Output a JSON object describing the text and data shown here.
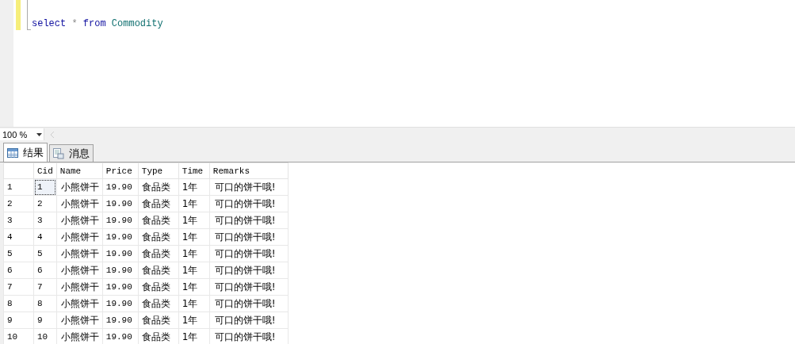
{
  "editor": {
    "query": [
      {
        "text": "select",
        "kind": "keyword"
      },
      {
        "text": "*",
        "kind": "operator"
      },
      {
        "text": "from",
        "kind": "keyword"
      },
      {
        "text": "Commodity",
        "kind": "identifier"
      }
    ]
  },
  "zoom": {
    "value": "100 %"
  },
  "tabs": [
    {
      "label": "结果",
      "selected": true,
      "kind": "grid"
    },
    {
      "label": "消息",
      "selected": false,
      "kind": "messages"
    }
  ],
  "table": {
    "columns": [
      "Cid",
      "Name",
      "Price",
      "Type",
      "Time",
      "Remarks"
    ],
    "rows": [
      {
        "number": "1",
        "cells": [
          "1",
          "小熊饼干",
          "19.90",
          "食品类",
          "1年",
          "可口的饼干哦!"
        ],
        "selected": true
      },
      {
        "number": "2",
        "cells": [
          "2",
          "小熊饼干",
          "19.90",
          "食品类",
          "1年",
          "可口的饼干哦!"
        ],
        "selected": false
      },
      {
        "number": "3",
        "cells": [
          "3",
          "小熊饼干",
          "19.90",
          "食品类",
          "1年",
          "可口的饼干哦!"
        ],
        "selected": false
      },
      {
        "number": "4",
        "cells": [
          "4",
          "小熊饼干",
          "19.90",
          "食品类",
          "1年",
          "可口的饼干哦!"
        ],
        "selected": false
      },
      {
        "number": "5",
        "cells": [
          "5",
          "小熊饼干",
          "19.90",
          "食品类",
          "1年",
          "可口的饼干哦!"
        ],
        "selected": false
      },
      {
        "number": "6",
        "cells": [
          "6",
          "小熊饼干",
          "19.90",
          "食品类",
          "1年",
          "可口的饼干哦!"
        ],
        "selected": false
      },
      {
        "number": "7",
        "cells": [
          "7",
          "小熊饼干",
          "19.90",
          "食品类",
          "1年",
          "可口的饼干哦!"
        ],
        "selected": false
      },
      {
        "number": "8",
        "cells": [
          "8",
          "小熊饼干",
          "19.90",
          "食品类",
          "1年",
          "可口的饼干哦!"
        ],
        "selected": false
      },
      {
        "number": "9",
        "cells": [
          "9",
          "小熊饼干",
          "19.90",
          "食品类",
          "1年",
          "可口的饼干哦!"
        ],
        "selected": false
      },
      {
        "number": "10",
        "cells": [
          "10",
          "小熊饼干",
          "19.90",
          "食品类",
          "1年",
          "可口的饼干哦!"
        ],
        "selected": false
      }
    ]
  }
}
